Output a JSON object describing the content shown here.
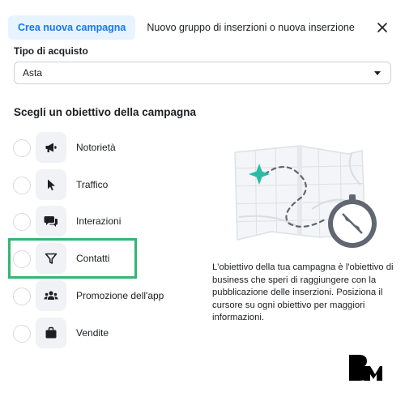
{
  "tabs": {
    "active": "Crea nuova campagna",
    "inactive": "Nuovo gruppo di inserzioni o nuova inserzione"
  },
  "purchase_type": {
    "label": "Tipo di acquisto",
    "value": "Asta"
  },
  "objectives": {
    "title": "Scegli un obiettivo della campagna",
    "items": [
      {
        "label": "Notorietà",
        "icon": "megaphone-icon"
      },
      {
        "label": "Traffico",
        "icon": "cursor-icon"
      },
      {
        "label": "Interazioni",
        "icon": "chat-bubbles-icon"
      },
      {
        "label": "Contatti",
        "icon": "funnel-icon"
      },
      {
        "label": "Promozione dell'app",
        "icon": "people-icon"
      },
      {
        "label": "Vendite",
        "icon": "shopping-bag-icon"
      }
    ],
    "highlighted": "Contatti"
  },
  "description": "L'obiettivo della tua campagna è l'obiettivo di business che speri di raggiungere con la pubblicazione delle inserzioni. Posiziona il cursore su ogni obiettivo per maggiori informazioni.",
  "colors": {
    "accent": "#1877f2",
    "active_tab_bg": "#e7f3ff",
    "highlight": "#2fb872",
    "icon_bg": "#f0f2f5"
  }
}
